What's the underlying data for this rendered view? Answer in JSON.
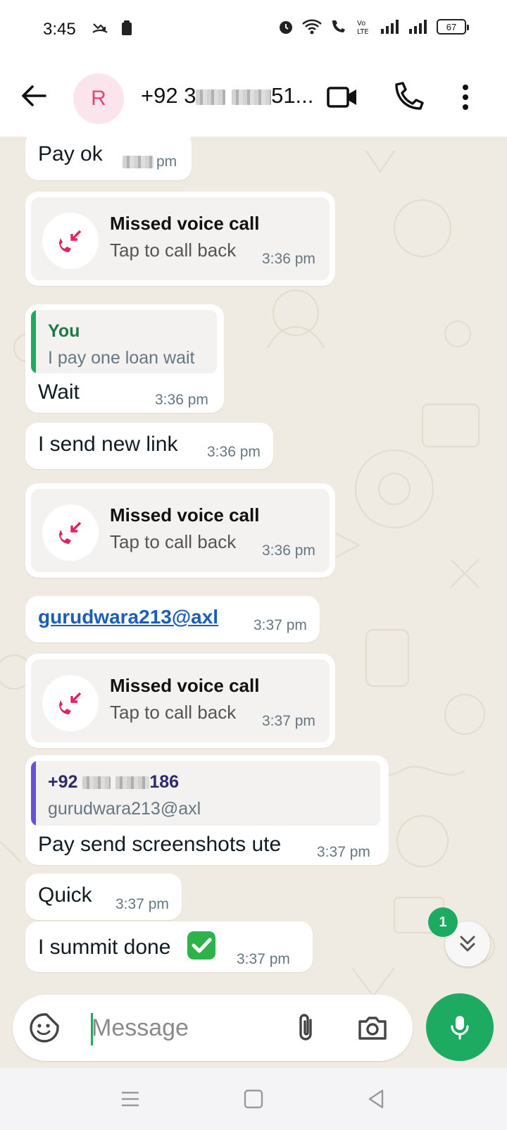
{
  "status_bar": {
    "time": "3:45",
    "battery": "67"
  },
  "header": {
    "avatar_initial": "R",
    "contact_prefix": "+92 3",
    "contact_suffix": "51..."
  },
  "messages": [
    {
      "text": "Pay ok",
      "time": "pm"
    },
    {
      "missed_call": "Missed voice call",
      "action": "Tap to call back",
      "time": "3:36 pm"
    },
    {
      "quote_author": "You",
      "quote_text": "I pay one loan wait",
      "text": "Wait",
      "time": "3:36 pm"
    },
    {
      "text": "I send new link",
      "time": "3:36 pm"
    },
    {
      "missed_call": "Missed voice call",
      "action": "Tap to call back",
      "time": "3:36 pm"
    },
    {
      "link": "gurudwara213@axl",
      "time": "3:37 pm"
    },
    {
      "missed_call": "Missed voice call",
      "action": "Tap to call back",
      "time": "3:37 pm"
    },
    {
      "quote_author_prefix": "+92",
      "quote_author_suffix": "186",
      "quote_text": "gurudwara213@axl",
      "text": "Pay send screenshots ute",
      "time": "3:37 pm"
    },
    {
      "text": "Quick",
      "time": "3:37 pm"
    },
    {
      "text": "I summit done",
      "time": "3:37 pm"
    }
  ],
  "unread_count": "1",
  "composer": {
    "placeholder": "Message"
  },
  "colors": {
    "accent": "#1daa61",
    "missed_call": "#e0245e",
    "chat_bg": "#efeae2",
    "quote_you": "#1daa61",
    "quote_other": "#6a4fd8"
  }
}
